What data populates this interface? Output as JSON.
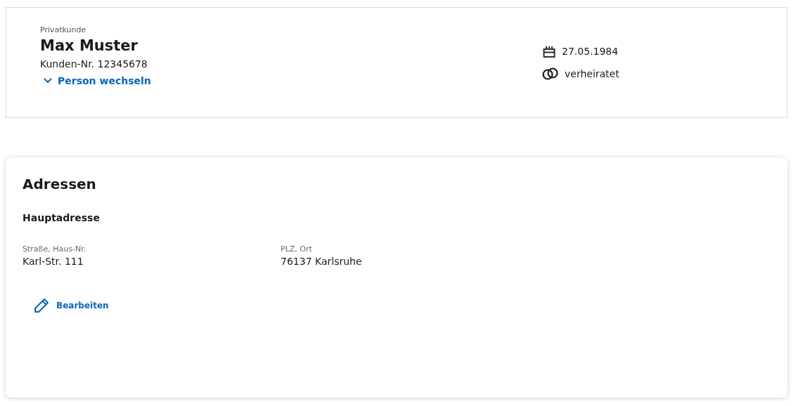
{
  "customer": {
    "type_label": "Privatkunde",
    "name": "Max Muster",
    "number": "Kunden-Nr. 12345678",
    "switch_link": "Person wechseln",
    "facts": [
      {
        "kind": "birthday",
        "text": "27.05.1984"
      },
      {
        "kind": "marital",
        "text": "verheiratet"
      }
    ]
  },
  "addresses": {
    "title": "Adressen",
    "subtitle": "Hauptadresse",
    "fields": [
      {
        "label": "Straße, Haus-Nr.",
        "value": "Karl-Str. 111"
      },
      {
        "label": "PLZ, Ort",
        "value": "76137 Karlsruhe"
      }
    ],
    "edit_button": "Bearbeiten"
  }
}
